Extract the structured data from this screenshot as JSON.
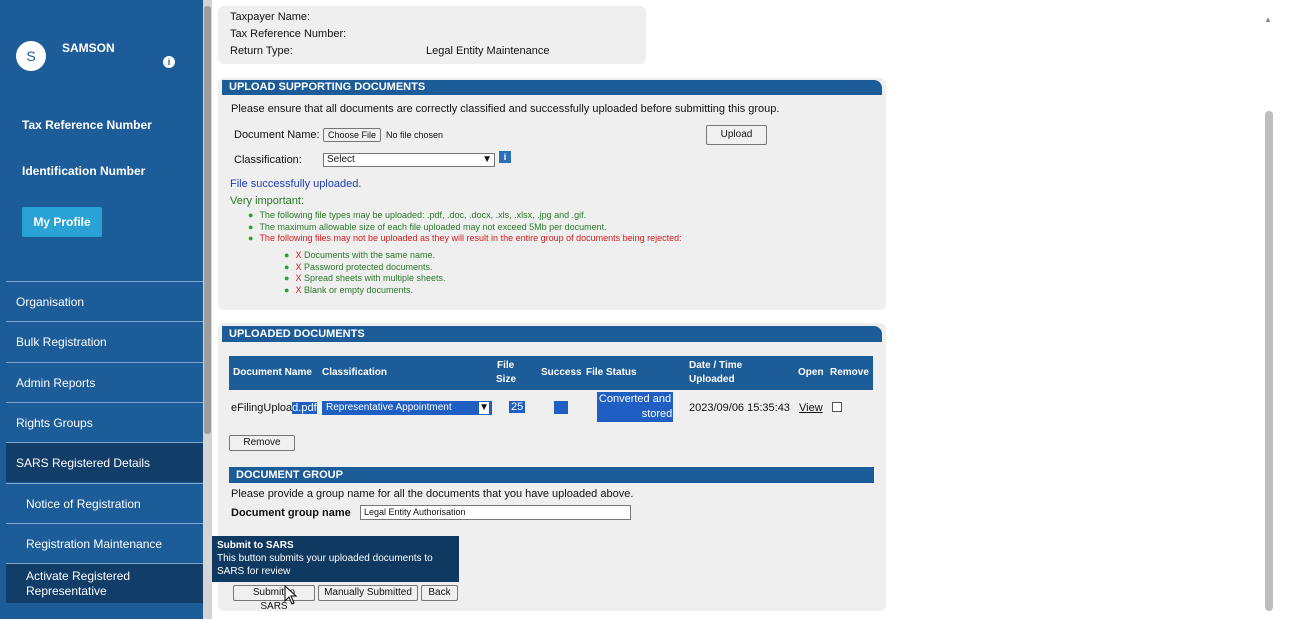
{
  "user": {
    "initial": "S",
    "name": "SAMSON"
  },
  "sidebar": {
    "tax_reference_label": "Tax Reference Number",
    "identification_label": "Identification Number",
    "profile_button": "My Profile",
    "items": [
      {
        "label": "Organisation"
      },
      {
        "label": "Bulk Registration"
      },
      {
        "label": "Admin Reports"
      },
      {
        "label": "Rights Groups"
      },
      {
        "label": "SARS Registered Details"
      },
      {
        "label": "Notice of Registration"
      },
      {
        "label": "Registration Maintenance"
      },
      {
        "label": "Activate Registered Representative"
      }
    ]
  },
  "taxpayer": {
    "name_label": "Taxpayer Name:",
    "ref_label": "Tax Reference Number:",
    "return_label": "Return Type:",
    "return_value": "Legal Entity Maintenance"
  },
  "upload": {
    "title": "UPLOAD SUPPORTING DOCUMENTS",
    "instruction": "Please ensure that all documents are correctly classified and successfully uploaded before submitting this group.",
    "doc_name_label": "Document Name:",
    "choose_file_button": "Choose File",
    "no_file_text": "No file chosen",
    "upload_button": "Upload",
    "classification_label": "Classification:",
    "classification_value": "Select",
    "success_message": "File successfully uploaded.",
    "important_label": "Very important:",
    "rules": [
      "The following file types may be uploaded: .pdf, .doc, .docx, .xls, .xlsx, .jpg and .gif.",
      "The maximum allowable size of each file uploaded may not exceed 5Mb per document.",
      "The following files may not be uploaded as they will result in the entire group of documents being rejected:"
    ],
    "rejected": [
      "Documents with the same name.",
      "Password protected documents.",
      "Spread sheets with multiple sheets.",
      "Blank or empty documents."
    ]
  },
  "uploaded": {
    "title": "UPLOADED DOCUMENTS",
    "columns": {
      "doc_name": "Document Name",
      "classification": "Classification",
      "file_size_1": "File",
      "file_size_2": "Size",
      "success": "Success",
      "file_status": "File Status",
      "date_1": "Date / Time",
      "date_2": "Uploaded",
      "open": "Open",
      "remove": "Remove"
    },
    "row": {
      "doc_name_a": "eFilingUploa",
      "doc_name_b": "d.pdf",
      "classification": "Representative Appointment",
      "size": "25",
      "status_1": "Converted and",
      "status_2": "stored",
      "date": "2023/09/06 15:35:43",
      "open": "View"
    },
    "remove_button": "Remove"
  },
  "group": {
    "title": "DOCUMENT GROUP",
    "instruction": "Please provide a group name for all the documents that you have uploaded above.",
    "name_label": "Document group name",
    "name_value": "Legal Entity Authorisation"
  },
  "tooltip": {
    "title": "Submit to SARS",
    "line1": "This button submits your uploaded documents to",
    "line2": "SARS for review"
  },
  "actions": {
    "submit": "Submit to SARS",
    "manual": "Manually Submitted",
    "back": "Back"
  },
  "colors": {
    "brand_blue": "#1c5c98",
    "accent": "#29a2d6",
    "selection": "#1f5fc4"
  }
}
